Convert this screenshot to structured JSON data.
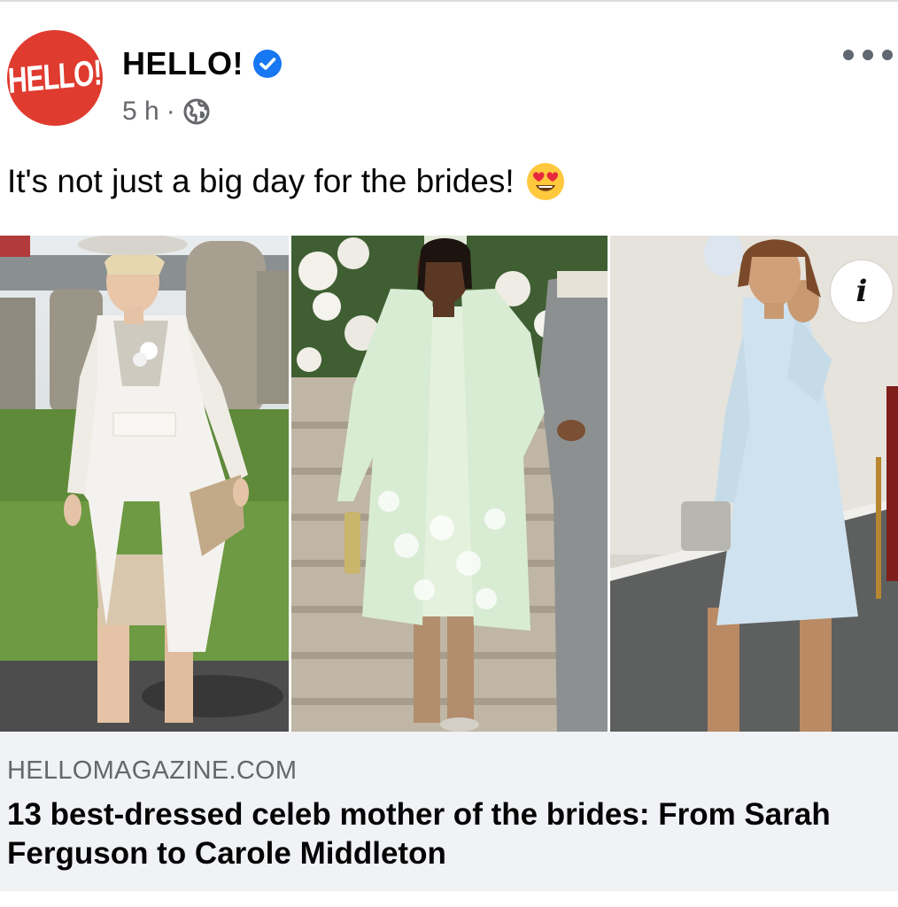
{
  "post": {
    "page_name": "HELLO!",
    "logo_text": "HELLO!",
    "time": "5 h",
    "separator": "·",
    "audience_icon": "globe-icon",
    "verified_icon": "verified-badge-icon",
    "more_icon": "more-options-icon",
    "caption": "It's not just a big day for the brides!",
    "caption_emoji": "smiling-face-with-heart-eyes-icon"
  },
  "photos": [
    {
      "name": "photo-mother-white-coat",
      "outfit_color": "#f4f2ee"
    },
    {
      "name": "photo-mother-mint-coat",
      "outfit_color": "#d8ecd3"
    },
    {
      "name": "photo-mother-light-blue-dress",
      "outfit_color": "#cfe2ef"
    }
  ],
  "info_button": {
    "label": "i",
    "icon": "info-icon"
  },
  "link_preview": {
    "domain": "HELLOMAGAZINE.COM",
    "title": "13 best-dressed celeb mother of the brides: From Sarah Ferguson to Carole Middleton"
  },
  "colors": {
    "brand_red": "#e03b2f",
    "verified_blue": "#1877f2",
    "secondary_text": "#65676b",
    "link_bg": "#f0f2f5"
  }
}
